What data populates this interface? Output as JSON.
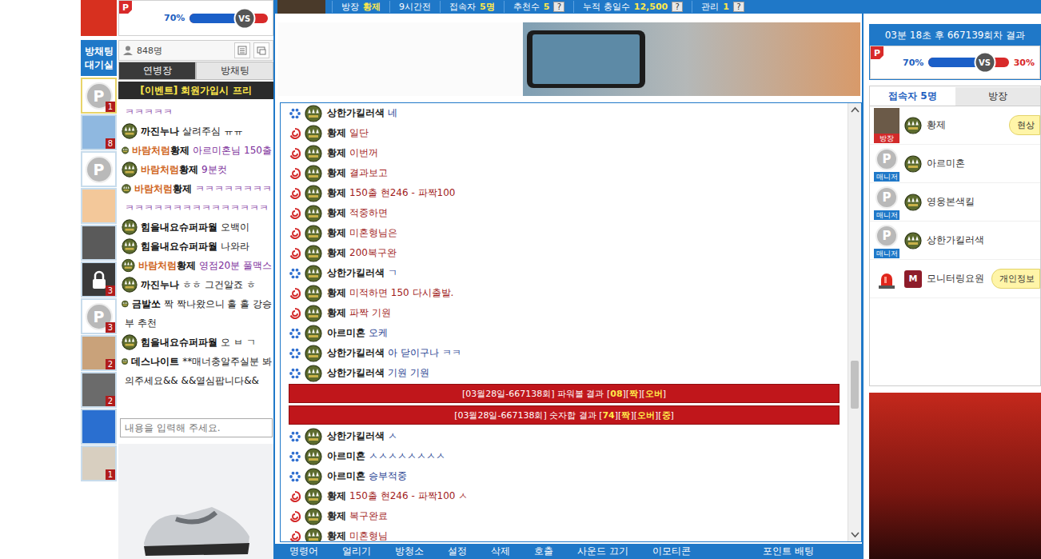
{
  "waiting_room": {
    "label": "방채팅 대기실"
  },
  "avatars": [
    {
      "kind": "p",
      "mark": "P",
      "badge": "1",
      "selected": true,
      "color": "#dcdcdc"
    },
    {
      "kind": "photo",
      "mark": "",
      "badge": "8",
      "selected": false,
      "color": "#8fb8e0"
    },
    {
      "kind": "p",
      "mark": "P",
      "badge": "",
      "selected": false,
      "color": "#dcdcdc"
    },
    {
      "kind": "photo",
      "mark": "",
      "badge": "",
      "selected": false,
      "color": "#f3c89a"
    },
    {
      "kind": "photo",
      "mark": "",
      "badge": "",
      "selected": false,
      "color": "#5a5a5a"
    },
    {
      "kind": "lock",
      "mark": "",
      "badge": "3",
      "selected": false,
      "color": "#3a3a3a"
    },
    {
      "kind": "p",
      "mark": "P",
      "badge": "3",
      "selected": false,
      "color": "#dcdcdc"
    },
    {
      "kind": "photo",
      "mark": "",
      "badge": "2",
      "selected": false,
      "color": "#c9a27a"
    },
    {
      "kind": "photo",
      "mark": "",
      "badge": "2",
      "selected": false,
      "color": "#6b6b6b"
    },
    {
      "kind": "photo",
      "mark": "",
      "badge": "",
      "selected": false,
      "color": "#2a6fd0"
    },
    {
      "kind": "photo",
      "mark": "",
      "badge": "1",
      "selected": false,
      "color": "#d8cfc0"
    }
  ],
  "left_panel": {
    "power_bar": {
      "logo": "P",
      "left_percent": "70%",
      "level": 0.7,
      "vs": "VS"
    },
    "header": {
      "count": "848명"
    },
    "tabs": [
      {
        "label": "연병장",
        "selected": true
      },
      {
        "label": "방채팅",
        "selected": false
      }
    ],
    "event": "[이벤트] 회원가입시 프리",
    "chat": [
      {
        "icon": false,
        "title": "",
        "name": "",
        "text": "ㅋㅋㅋㅋㅋ",
        "tone": "purple"
      },
      {
        "icon": true,
        "title": "",
        "name": "까진누나",
        "text": "살려주심 ㅠㅠ",
        "tone": "normal"
      },
      {
        "icon": true,
        "title": "바람처럼",
        "name": "황제",
        "text": "아르미혼님 150출",
        "tone": "purple"
      },
      {
        "icon": true,
        "title": "바람처럼",
        "name": "황제",
        "text": "9분컷",
        "tone": "purple"
      },
      {
        "icon": true,
        "title": "바람처럼",
        "name": "황제",
        "text": "ㅋㅋㅋㅋㅋㅋㅋㅋ",
        "tone": "purple"
      },
      {
        "icon": false,
        "title": "",
        "name": "",
        "text": "ㅋㅋㅋㅋㅋㅋㅋㅋㅋㅋㅋㅋㅋㅋㅋ",
        "tone": "purple"
      },
      {
        "icon": true,
        "title": "",
        "name": "힘을내요슈퍼파월",
        "text": "오백이",
        "tone": "normal"
      },
      {
        "icon": true,
        "title": "",
        "name": "힘을내요슈퍼파월",
        "text": "나와라",
        "tone": "normal"
      },
      {
        "icon": true,
        "title": "바람처럼",
        "name": "황제",
        "text": "영점20분 풀맥스",
        "tone": "purple"
      },
      {
        "icon": true,
        "title": "",
        "name": "까진누나",
        "text": "ㅎㅎ 그건알죠 ㅎ",
        "tone": "normal"
      },
      {
        "icon": true,
        "title": "",
        "name": "금발쏘",
        "text": "짝 짝나왔으니 홀 홀 강승",
        "tone": "normal"
      },
      {
        "icon": false,
        "title": "",
        "name": "",
        "text": "부 추천",
        "tone": "normal"
      },
      {
        "icon": true,
        "title": "",
        "name": "힘을내요슈퍼파월",
        "text": "오 ㅂ ㄱ",
        "tone": "normal"
      },
      {
        "icon": true,
        "title": "",
        "name": "데스나이트",
        "text": "**매너충알주실분 봐",
        "tone": "normal"
      },
      {
        "icon": false,
        "title": "",
        "name": "",
        "text": "의주세요&&  &&열심팝니다&&",
        "tone": "normal"
      }
    ],
    "input_placeholder": "내용을 입력해 주세요."
  },
  "top_bar": [
    {
      "label": "방장",
      "value": "황제",
      "help": ""
    },
    {
      "label": "9시간전",
      "value": "",
      "help": ""
    },
    {
      "label": "접속자",
      "value": "5명",
      "help": ""
    },
    {
      "label": "추천수",
      "value": "5",
      "help": "?"
    },
    {
      "label": "누적 충일수",
      "value": "12,500",
      "help": "?"
    },
    {
      "label": "관리",
      "value": "1",
      "help": "?"
    }
  ],
  "chat": [
    {
      "kind": "message",
      "role": "member",
      "name": "상한가킬러색",
      "text": "네"
    },
    {
      "kind": "message",
      "role": "host",
      "name": "황제",
      "text": "일단"
    },
    {
      "kind": "message",
      "role": "host",
      "name": "황제",
      "text": "이번꺼"
    },
    {
      "kind": "message",
      "role": "host",
      "name": "황제",
      "text": "결과보고"
    },
    {
      "kind": "message",
      "role": "host",
      "name": "황제",
      "text": "150출 현246 - 파짝100"
    },
    {
      "kind": "message",
      "role": "host",
      "name": "황제",
      "text": "적중하면"
    },
    {
      "kind": "message",
      "role": "host",
      "name": "황제",
      "text": "미혼형님은"
    },
    {
      "kind": "message",
      "role": "host",
      "name": "황제",
      "text": "200복구완"
    },
    {
      "kind": "message",
      "role": "member",
      "name": "상한가킬러색",
      "text": "ㄱ"
    },
    {
      "kind": "message",
      "role": "host",
      "name": "황제",
      "text": "미적하면 150 다시출발."
    },
    {
      "kind": "message",
      "role": "host",
      "name": "황제",
      "text": "파짝 기원"
    },
    {
      "kind": "message",
      "role": "member",
      "name": "아르미혼",
      "text": "오케"
    },
    {
      "kind": "message",
      "role": "member",
      "name": "상한가킬러색",
      "text": "아 닫이구나 ㅋㅋ"
    },
    {
      "kind": "message",
      "role": "member",
      "name": "상한가킬러색",
      "text": "기원 기원"
    },
    {
      "kind": "result",
      "segments": [
        {
          "text": "[03월28일-667138회] 파워볼 결과 [",
          "highlight": false
        },
        {
          "text": "08",
          "highlight": true
        },
        {
          "text": "][",
          "highlight": false
        },
        {
          "text": "짝",
          "highlight": true
        },
        {
          "text": "][",
          "highlight": false
        },
        {
          "text": "오버",
          "highlight": true
        },
        {
          "text": "]",
          "highlight": false
        }
      ]
    },
    {
      "kind": "result",
      "segments": [
        {
          "text": "[03월28일-667138회] 숫자합 결과 [",
          "highlight": false
        },
        {
          "text": "74",
          "highlight": true
        },
        {
          "text": "][",
          "highlight": false
        },
        {
          "text": "짝",
          "highlight": true
        },
        {
          "text": "][",
          "highlight": false
        },
        {
          "text": "오버",
          "highlight": true
        },
        {
          "text": "][",
          "highlight": false
        },
        {
          "text": "중",
          "highlight": true
        },
        {
          "text": "]",
          "highlight": false
        }
      ]
    },
    {
      "kind": "message",
      "role": "member",
      "name": "상한가킬러색",
      "text": "ㅅ"
    },
    {
      "kind": "message",
      "role": "member",
      "name": "아르미혼",
      "text": "ㅅㅅㅅㅅㅅㅅㅅㅅ"
    },
    {
      "kind": "message",
      "role": "member",
      "name": "아르미혼",
      "text": "승부적중"
    },
    {
      "kind": "message",
      "role": "host",
      "name": "황제",
      "text": "150출 현246 - 파짝100 ㅅ"
    },
    {
      "kind": "message",
      "role": "host",
      "name": "황제",
      "text": "복구완료"
    },
    {
      "kind": "message",
      "role": "host",
      "name": "황제",
      "text": "미혼형님"
    }
  ],
  "scrollbar": {
    "level": 0.66
  },
  "bottom_menu": {
    "items": [
      "명령어",
      "얼리기",
      "방청소",
      "설정",
      "삭제",
      "호출",
      "사운드 끄기",
      "이모티콘"
    ],
    "right_item": "포인트 배팅"
  },
  "right_panel": {
    "timer": "03분 18초 후 667139회차 결과",
    "power_bar": {
      "logo": "P",
      "left_percent": "70%",
      "right_percent": "30%",
      "level": 0.7,
      "vs": "VS"
    },
    "tabs": [
      {
        "label": "접속자 5명",
        "selected": true
      },
      {
        "label": "방장",
        "selected": false
      }
    ],
    "users": [
      {
        "name": "황제",
        "role": "방장",
        "color": "#d22a2a",
        "avatar": "photo",
        "mark": "",
        "badge": "",
        "bubble": "현상"
      },
      {
        "name": "아르미혼",
        "role": "매니저",
        "color": "#1f78c8",
        "avatar": "p",
        "mark": "P",
        "badge": "",
        "bubble": ""
      },
      {
        "name": "영웅본색킬",
        "role": "매니저",
        "color": "#1f78c8",
        "avatar": "p",
        "mark": "P",
        "badge": "",
        "bubble": ""
      },
      {
        "name": "상한가킬러색",
        "role": "매니저",
        "color": "#1f78c8",
        "avatar": "p",
        "mark": "P",
        "badge": "",
        "bubble": ""
      },
      {
        "name": "모니터링요원",
        "role": "",
        "color": "#ffffff",
        "avatar": "siren",
        "mark": "",
        "badge": "M",
        "bubble": "개인정보"
      }
    ]
  }
}
